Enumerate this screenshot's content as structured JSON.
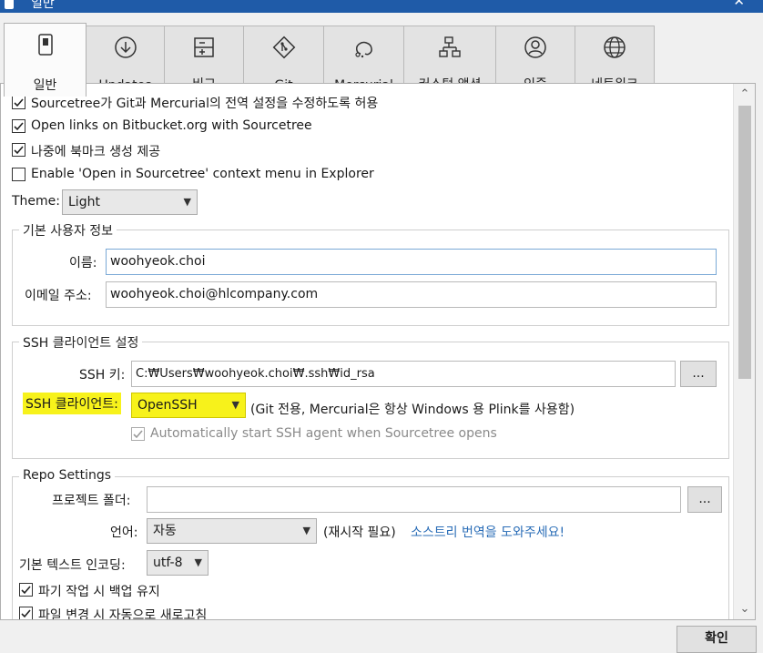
{
  "window": {
    "title": "일반",
    "close_glyph": "✕"
  },
  "tabs": [
    {
      "label": "일반",
      "icon": "switch-icon",
      "active": true
    },
    {
      "label": "Updates",
      "icon": "download-circle-icon"
    },
    {
      "label": "비교",
      "icon": "compare-icon"
    },
    {
      "label": "Git",
      "icon": "git-icon"
    },
    {
      "label": "Mercurial",
      "icon": "mercurial-icon"
    },
    {
      "label": "커스텀 액션",
      "icon": "flow-icon"
    },
    {
      "label": "인증",
      "icon": "user-icon"
    },
    {
      "label": "네트워크",
      "icon": "globe-icon"
    }
  ],
  "general": {
    "options": [
      {
        "label": "Sourcetree가 Git과 Mercurial의 전역 설정을 수정하도록 허용",
        "checked": true
      },
      {
        "label": "Open links on Bitbucket.org with Sourcetree",
        "checked": true
      },
      {
        "label": "나중에 북마크 생성 제공",
        "checked": true
      },
      {
        "label": "Enable 'Open in Sourcetree' context menu in Explorer",
        "checked": false
      }
    ],
    "theme_label": "Theme:",
    "theme_value": "Light"
  },
  "user_info": {
    "legend": "기본 사용자 정보",
    "name_label": "이름:",
    "name_value": "woohyeok.choi",
    "email_label": "이메일 주소:",
    "email_value": "woohyeok.choi@hlcompany.com"
  },
  "ssh": {
    "legend": "SSH 클라이언트 설정",
    "key_label": "SSH 키:",
    "key_value": "C:₩Users₩woohyeok.choi₩.ssh₩id_rsa",
    "browse_label": "...",
    "client_label": "SSH 클라이언트:",
    "client_value": "OpenSSH",
    "client_note": "(Git 전용, Mercurial은 항상 Windows 용 Plink를 사용함)",
    "auto_agent_label": "Automatically start SSH agent when Sourcetree opens",
    "auto_agent_checked": true,
    "highlight_color": "#f7f21b"
  },
  "repo": {
    "legend": "Repo Settings",
    "folder_label": "프로젝트 폴더:",
    "folder_value": "",
    "browse_label": "...",
    "language_label": "언어:",
    "language_value": "자동",
    "restart_note": "(재시작 필요)",
    "translate_link": "소스트리 번역을 도와주세요!",
    "encoding_label": "기본 텍스트 인코딩:",
    "encoding_value": "utf-8",
    "backup_label": "파기 작업 시 백업 유지",
    "backup_checked": true,
    "refresh_label": "파일 변경 시 자동으로 새로고침",
    "refresh_checked": true
  },
  "footer": {
    "ok_label": "확인"
  },
  "colors": {
    "titlebar": "#1f5ba8",
    "link": "#2a6db7",
    "panel": "#ffffff"
  }
}
